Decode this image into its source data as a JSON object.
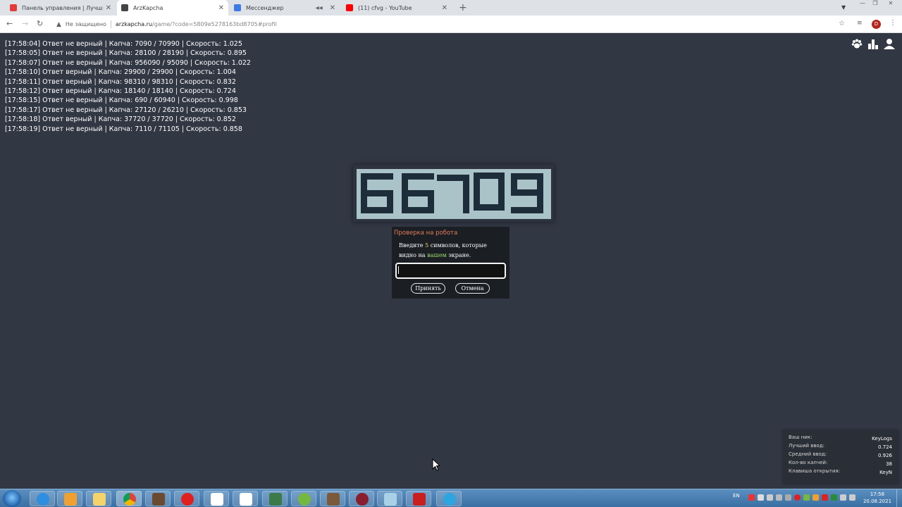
{
  "browser": {
    "tabs": [
      {
        "title": "Панель управления | Лучший б",
        "favicon_color": "#e33b3b",
        "active": false
      },
      {
        "title": "ArzKapcha",
        "favicon_color": "#444444",
        "active": true
      },
      {
        "title": "Мессенджер",
        "favicon_color": "#3b7be3",
        "active": false
      },
      {
        "title": "(11) cfvg - YouTube",
        "favicon_color": "#ff0000",
        "active": false
      }
    ],
    "new_tab": "+",
    "insecure_label": "Не защищено",
    "url_host": "arzkapcha.ru",
    "url_path": "/game/?code=5809e5278163bd8705#profil",
    "profile_letter": "D"
  },
  "log": [
    "[17:58:04] Ответ не верный | Капча: 7090 / 70990 | Скорость: 1.025",
    "[17:58:05] Ответ не верный | Капча: 28100 / 28190 | Скорость: 0.895",
    "[17:58:07] Ответ не верный | Капча: 956090 / 95090 | Скорость: 1.022",
    "[17:58:10] Ответ верный | Капча: 29900 / 29900 | Скорость: 1.004",
    "[17:58:11] Ответ верный | Капча: 98310 / 98310 | Скорость: 0.832",
    "[17:58:12] Ответ верный | Капча: 18140 / 18140 | Скорость: 0.724",
    "[17:58:15] Ответ не верный | Капча: 690 / 60940 | Скорость: 0.998",
    "[17:58:17] Ответ не верный | Капча: 27120 / 26210 | Скорость: 0.853",
    "[17:58:18] Ответ верный | Капча: 37720 / 37720 | Скорость: 0.852",
    "[17:58:19] Ответ не верный | Капча: 7110 / 71105 | Скорость: 0.858"
  ],
  "captcha": {
    "code": "66709"
  },
  "dialog": {
    "title": "Проверка на робота",
    "text_before": "Введите ",
    "count": "5",
    "text_middle": " символов, которые видно на ",
    "highlight": "вашем",
    "text_after": " экране.",
    "input_value": "",
    "accept_label": "Принять",
    "cancel_label": "Отмена"
  },
  "stats": {
    "nick_label": "Ваш ник:",
    "nick": "KeyLogs",
    "best_label": "Лучший ввод:",
    "best": "0.724",
    "avg_label": "Средний ввод:",
    "avg": "0.926",
    "count_label": "Кол-во капчей:",
    "count": "38",
    "key_label": "Клавиша открытия:",
    "key": "KeyN"
  },
  "taskbar": {
    "lang": "EN",
    "time": "17:58",
    "date": "20.08.2021"
  },
  "colors": {
    "page_bg": "#313743",
    "dialog_title": "#e27c5a",
    "highlight_count": "#e8d36a",
    "highlight_word": "#9bdc6b"
  }
}
